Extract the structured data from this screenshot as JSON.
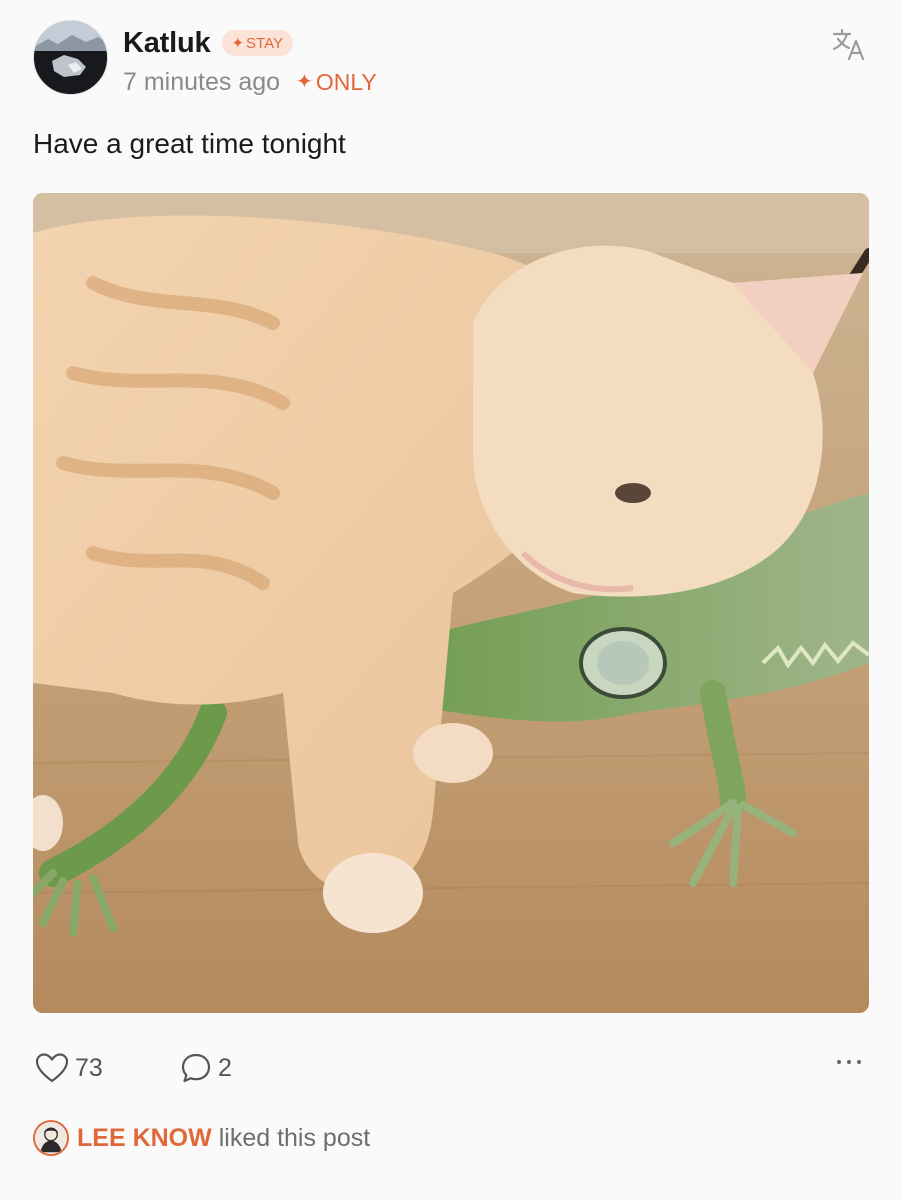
{
  "post": {
    "author": {
      "name": "Katluk",
      "badge": "STAY",
      "avatar_icon": "avatar-photo-icon"
    },
    "timestamp": "7 minutes ago",
    "visibility": "ONLY",
    "text": "Have a great time tonight",
    "image_icon": "cat-and-iguana-photo",
    "actions": {
      "like_count": "73",
      "comment_count": "2",
      "like_icon": "heart-icon",
      "comment_icon": "comment-bubble-icon",
      "more_icon": "more-dots-icon",
      "translate_icon": "translate-icon"
    },
    "liked_by": {
      "name": "LEE KNOW",
      "suffix": "liked this post"
    }
  },
  "colors": {
    "accent": "#e0683a",
    "badge_bg": "#fbe3d8",
    "muted_text": "#8a8a8a",
    "background": "#fafafa"
  }
}
